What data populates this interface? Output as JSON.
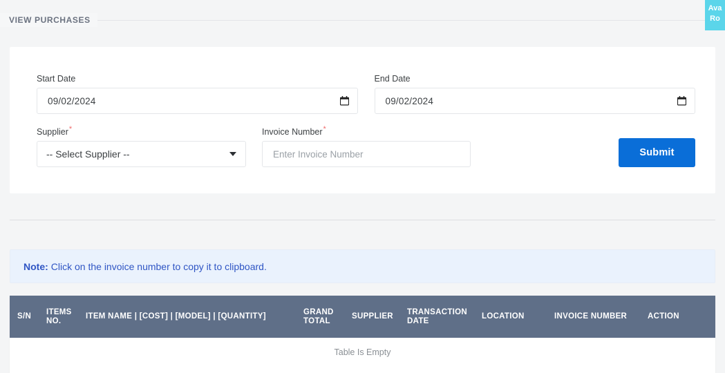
{
  "header": {
    "title": "VIEW PURCHASES"
  },
  "corner_badge": {
    "line1": "Ava",
    "line2": "Ro",
    "color": "#5bd5ea"
  },
  "form": {
    "start_date": {
      "label": "Start Date",
      "value": "09/02/2024",
      "icon": "calendar-icon"
    },
    "end_date": {
      "label": "End Date",
      "value": "09/02/2024",
      "icon": "calendar-icon"
    },
    "supplier": {
      "label": "Supplier",
      "required_marker": "*",
      "selected": "-- Select Supplier --",
      "options": [
        "-- Select Supplier --"
      ],
      "icon": "chevron-down-icon"
    },
    "invoice_number": {
      "label": "Invoice Number",
      "required_marker": "*",
      "value": "",
      "placeholder": "Enter Invoice Number"
    },
    "submit": {
      "label": "Submit",
      "color": "#0a6ed8"
    }
  },
  "note": {
    "prefix": "Note:",
    "text": "Click on the invoice number to copy it to clipboard.",
    "background": "#eaf2fd",
    "text_color": "#2f55c4"
  },
  "table": {
    "header_color": "#5f6f88",
    "columns": [
      "S/N",
      "ITEMS NO.",
      "ITEM NAME | [COST] | [MODEL] | [QUANTITY]",
      "GRAND TOTAL",
      "SUPPLIER",
      "TRANSACTION DATE",
      "LOCATION",
      "INVOICE NUMBER",
      "ACTION"
    ],
    "rows": [],
    "empty_message": "Table Is Empty"
  }
}
